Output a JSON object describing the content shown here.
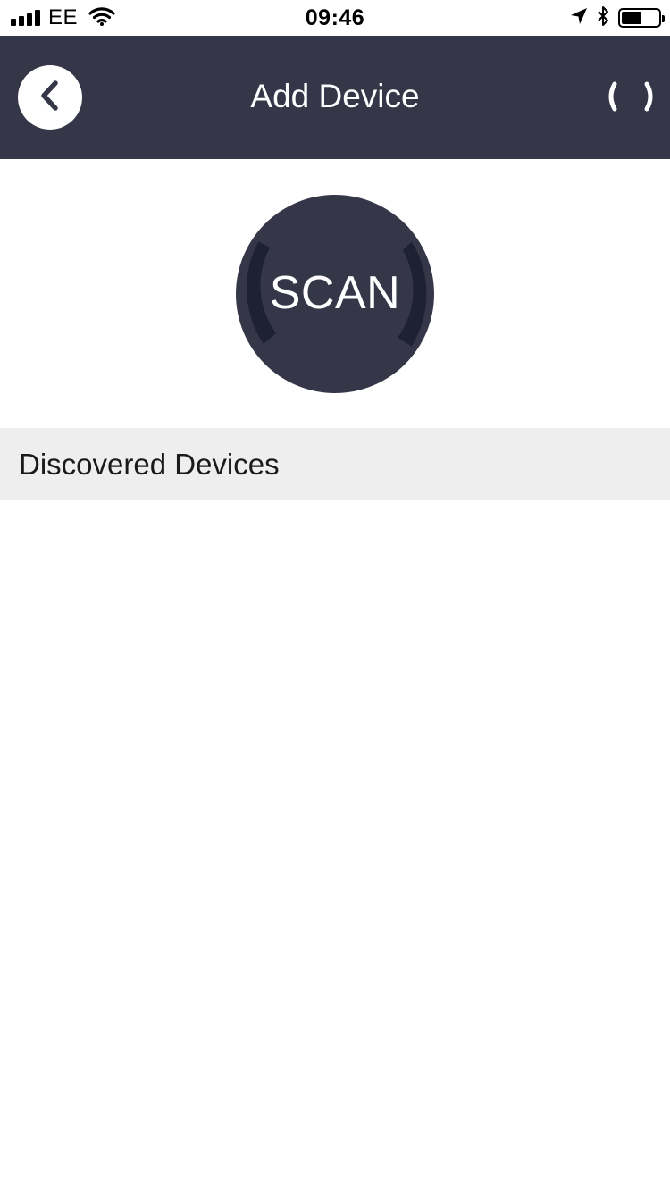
{
  "status_bar": {
    "carrier": "EE",
    "time": "09:46",
    "signal_bars": 4,
    "battery_level": 0.55,
    "icons": [
      "signal-icon",
      "wifi-icon",
      "location-arrow-icon",
      "bluetooth-icon",
      "battery-icon"
    ]
  },
  "header": {
    "title": "Add Device",
    "back_icon": "chevron-left-icon",
    "right_icon": "loading-spinner-icon",
    "background": "#353749"
  },
  "scan": {
    "label": "SCAN",
    "color": "#353749",
    "arc_color": "#1e2134"
  },
  "discovered": {
    "title": "Discovered Devices",
    "items": []
  }
}
